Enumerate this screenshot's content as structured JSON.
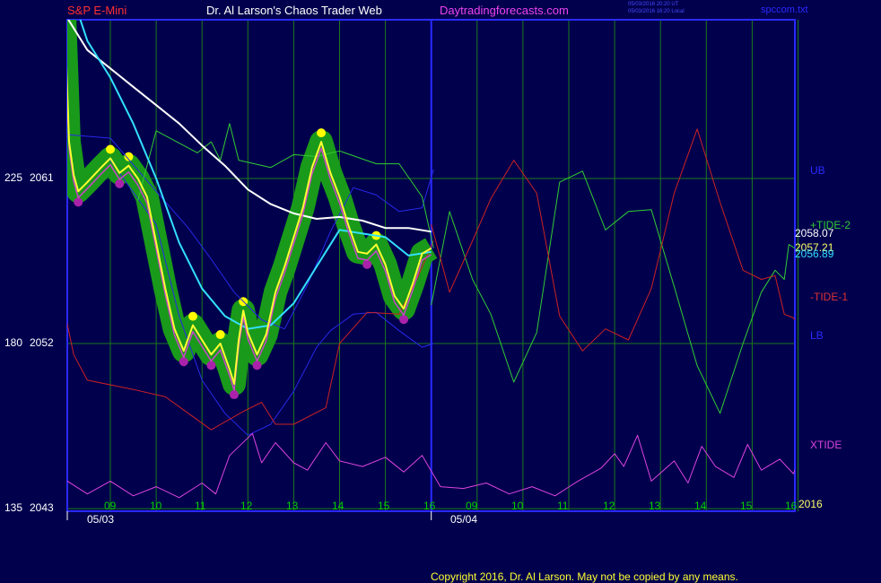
{
  "header": {
    "instrument": "S&P E-Mini",
    "title": "Dr. Al Larson's Chaos Trader Web",
    "site": "Daytradingforecasts.com",
    "stamp_line1": "05/03/2016 20:20 UT",
    "stamp_line2": "05/03/2016 16:20 Local",
    "file": "spccom.txt"
  },
  "footer": {
    "copyright": "Copyright 2016, Dr. Al Larson. May not be copied by any means."
  },
  "y_axis": {
    "labels": [
      {
        "left": "225",
        "right": "2061"
      },
      {
        "left": "180",
        "right": "2052"
      },
      {
        "left": "135",
        "right": "2043"
      }
    ]
  },
  "x_axis": {
    "day1_hours": [
      "09",
      "10",
      "11",
      "12",
      "13",
      "14",
      "15",
      "16"
    ],
    "day2_hours": [
      "09",
      "10",
      "11",
      "12",
      "13",
      "14",
      "15",
      "16"
    ],
    "dates": [
      "05/03",
      "05/04"
    ],
    "year": "2016"
  },
  "right_labels": {
    "ub": "UB",
    "tide2": "+TIDE-2",
    "price_white": "2058.07",
    "price_yellow": "2057.21",
    "price_cyan": "2056.89",
    "tide1": "-TIDE-1",
    "lb": "LB",
    "xtide": "XTIDE"
  },
  "colors": {
    "background": "#00004d",
    "grid_green": "#1c7a1c",
    "frame_blue": "#2a2aff",
    "band_blue": "#2828e8",
    "white_ma": "#ffffff",
    "cyan_ma": "#33e0ff",
    "yellow_price": "#ffff33",
    "magenta": "#cc44cc",
    "tide_green": "#33cc33",
    "tide_red": "#cc2222",
    "xtide": "#dd44dd",
    "highlight_green": "#1a9a1a",
    "high_dot": "#ffff00",
    "low_dot": "#aa22aa"
  },
  "chart_data": {
    "type": "line",
    "title": "S&P E-Mini",
    "x_dates": [
      "05/03",
      "05/04"
    ],
    "x_hours_per_day": [
      "09",
      "10",
      "11",
      "12",
      "13",
      "14",
      "15",
      "16"
    ],
    "y_ticks": [
      2043,
      2052,
      2061
    ],
    "ylim": [
      2043,
      2063
    ],
    "grid": true,
    "series": [
      {
        "name": "UB",
        "role": "upper band",
        "points": [
          [
            8.0,
            2063.4
          ],
          [
            9.0,
            2063.2
          ],
          [
            10.0,
            2060.3
          ],
          [
            10.7,
            2058.3
          ],
          [
            11.2,
            2056.6
          ],
          [
            11.7,
            2054.8
          ],
          [
            12.3,
            2053.3
          ],
          [
            12.8,
            2052.8
          ],
          [
            13.3,
            2055.2
          ],
          [
            13.8,
            2058.1
          ],
          [
            14.3,
            2060.5
          ],
          [
            14.8,
            2060.1
          ],
          [
            15.3,
            2059.2
          ],
          [
            15.8,
            2059.4
          ],
          [
            16.05,
            2061.5
          ]
        ]
      },
      {
        "name": "LB",
        "role": "lower band",
        "points": [
          [
            9.0,
            2062.0
          ],
          [
            10.0,
            2058.5
          ],
          [
            10.5,
            2053.5
          ],
          [
            11.0,
            2050.0
          ],
          [
            11.5,
            2048.2
          ],
          [
            12.0,
            2047.0
          ],
          [
            12.5,
            2047.6
          ],
          [
            13.0,
            2049.4
          ],
          [
            13.5,
            2051.8
          ],
          [
            13.8,
            2052.7
          ],
          [
            14.3,
            2053.6
          ],
          [
            14.8,
            2053.7
          ],
          [
            15.3,
            2052.7
          ],
          [
            15.8,
            2051.8
          ],
          [
            16.05,
            2052.0
          ]
        ]
      },
      {
        "name": "red envelope",
        "role": "lower envelope",
        "points": [
          [
            8.0,
            2053.8
          ],
          [
            8.2,
            2051.4
          ],
          [
            8.5,
            2050.0
          ],
          [
            9.5,
            2049.5
          ],
          [
            10.2,
            2049.1
          ],
          [
            10.7,
            2048.2
          ],
          [
            11.2,
            2047.3
          ],
          [
            11.9,
            2048.3
          ],
          [
            12.3,
            2048.8
          ],
          [
            12.6,
            2047.6
          ],
          [
            13.0,
            2047.6
          ],
          [
            13.7,
            2048.5
          ],
          [
            14.0,
            2052.0
          ],
          [
            14.6,
            2053.7
          ],
          [
            15.3,
            2053.6
          ],
          [
            15.7,
            2055.6
          ],
          [
            16.05,
            2057.6
          ]
        ]
      },
      {
        "name": "green envelope",
        "role": "upper envelope",
        "points": [
          [
            9.6,
            2059.8
          ],
          [
            10.0,
            2063.6
          ],
          [
            10.9,
            2062.4
          ],
          [
            11.2,
            2063.0
          ],
          [
            11.4,
            2062.0
          ],
          [
            11.6,
            2064.0
          ],
          [
            11.8,
            2062.0
          ],
          [
            12.5,
            2061.6
          ],
          [
            13.0,
            2062.3
          ],
          [
            13.5,
            2062.2
          ],
          [
            14.0,
            2062.5
          ],
          [
            14.8,
            2061.8
          ],
          [
            15.3,
            2061.8
          ],
          [
            15.8,
            2060.0
          ],
          [
            16.05,
            2057.2
          ]
        ]
      },
      {
        "name": "white MA",
        "points": [
          [
            8.0,
            2070
          ],
          [
            8.5,
            2068.0
          ],
          [
            9.0,
            2067.0
          ],
          [
            9.5,
            2066.0
          ],
          [
            10.0,
            2065.0
          ],
          [
            10.5,
            2064.0
          ],
          [
            11.0,
            2062.8
          ],
          [
            11.5,
            2061.7
          ],
          [
            12.0,
            2060.4
          ],
          [
            12.5,
            2059.6
          ],
          [
            13.0,
            2059.1
          ],
          [
            13.5,
            2058.8
          ],
          [
            14.0,
            2058.9
          ],
          [
            14.5,
            2058.7
          ],
          [
            15.0,
            2058.3
          ],
          [
            15.5,
            2058.3
          ],
          [
            16.0,
            2058.1
          ]
        ]
      },
      {
        "name": "cyan MA",
        "points": [
          [
            8.3,
            2070
          ],
          [
            8.5,
            2068.5
          ],
          [
            9.0,
            2066.5
          ],
          [
            9.5,
            2064.0
          ],
          [
            10.0,
            2061.0
          ],
          [
            10.5,
            2057.5
          ],
          [
            11.0,
            2055.0
          ],
          [
            11.5,
            2053.5
          ],
          [
            12.0,
            2052.8
          ],
          [
            12.5,
            2053.0
          ],
          [
            13.0,
            2054.2
          ],
          [
            13.5,
            2056.2
          ],
          [
            14.0,
            2058.2
          ],
          [
            14.5,
            2058.0
          ],
          [
            15.0,
            2057.8
          ],
          [
            15.5,
            2056.8
          ],
          [
            16.0,
            2057.0
          ]
        ]
      },
      {
        "name": "yellow price",
        "points": [
          [
            8.0,
            2070
          ],
          [
            8.1,
            2063.0
          ],
          [
            8.2,
            2061.2
          ],
          [
            8.3,
            2060.3
          ],
          [
            8.5,
            2060.8
          ],
          [
            8.8,
            2061.6
          ],
          [
            9.0,
            2062.1
          ],
          [
            9.2,
            2061.3
          ],
          [
            9.4,
            2061.7
          ],
          [
            9.6,
            2061.0
          ],
          [
            9.8,
            2060.0
          ],
          [
            10.0,
            2057.5
          ],
          [
            10.2,
            2055.0
          ],
          [
            10.4,
            2052.8
          ],
          [
            10.6,
            2051.6
          ],
          [
            10.8,
            2053.0
          ],
          [
            11.0,
            2052.2
          ],
          [
            11.2,
            2051.4
          ],
          [
            11.4,
            2052.0
          ],
          [
            11.6,
            2050.6
          ],
          [
            11.7,
            2049.8
          ],
          [
            11.8,
            2052.2
          ],
          [
            11.9,
            2053.8
          ],
          [
            12.0,
            2052.6
          ],
          [
            12.2,
            2051.4
          ],
          [
            12.4,
            2052.5
          ],
          [
            12.6,
            2054.8
          ],
          [
            12.8,
            2056.2
          ],
          [
            13.0,
            2057.8
          ],
          [
            13.2,
            2059.4
          ],
          [
            13.4,
            2061.6
          ],
          [
            13.6,
            2063.0
          ],
          [
            13.8,
            2061.3
          ],
          [
            14.0,
            2060.0
          ],
          [
            14.2,
            2058.4
          ],
          [
            14.4,
            2057.0
          ],
          [
            14.6,
            2056.9
          ],
          [
            14.8,
            2057.4
          ],
          [
            15.0,
            2056.3
          ],
          [
            15.2,
            2054.6
          ],
          [
            15.4,
            2053.9
          ],
          [
            15.6,
            2055.3
          ],
          [
            15.8,
            2056.9
          ],
          [
            16.0,
            2057.2
          ]
        ]
      },
      {
        "name": "+TIDE-2",
        "role": "forecast",
        "points": [
          [
            16.0,
            2054.1
          ],
          [
            16.4,
            2059.2
          ],
          [
            16.9,
            2055.5
          ],
          [
            17.3,
            2053.6
          ],
          [
            17.8,
            2049.9
          ],
          [
            18.3,
            2052.6
          ],
          [
            18.8,
            2060.8
          ],
          [
            19.3,
            2061.4
          ],
          [
            19.8,
            2058.2
          ],
          [
            20.3,
            2059.2
          ],
          [
            20.8,
            2059.3
          ],
          [
            21.3,
            2055.1
          ],
          [
            21.8,
            2050.8
          ],
          [
            22.3,
            2048.2
          ],
          [
            22.8,
            2052.0
          ],
          [
            23.2,
            2054.8
          ],
          [
            23.5,
            2056.0
          ],
          [
            23.7,
            2055.5
          ],
          [
            23.8,
            2057.4
          ],
          [
            24.0,
            2057.1
          ],
          [
            24.1,
            2058.4
          ]
        ]
      },
      {
        "name": "-TIDE-1",
        "role": "forecast",
        "points": [
          [
            16.0,
            2058.5
          ],
          [
            16.4,
            2054.8
          ],
          [
            16.9,
            2057.6
          ],
          [
            17.3,
            2059.9
          ],
          [
            17.8,
            2062.0
          ],
          [
            18.3,
            2060.2
          ],
          [
            18.8,
            2053.5
          ],
          [
            19.3,
            2051.6
          ],
          [
            19.8,
            2052.8
          ],
          [
            20.3,
            2052.2
          ],
          [
            20.8,
            2055.0
          ],
          [
            21.3,
            2060.2
          ],
          [
            21.8,
            2063.7
          ],
          [
            22.3,
            2059.7
          ],
          [
            22.8,
            2056.0
          ],
          [
            23.2,
            2055.5
          ],
          [
            23.5,
            2055.7
          ],
          [
            23.7,
            2053.6
          ],
          [
            23.9,
            2053.4
          ],
          [
            24.1,
            2052.8
          ]
        ]
      },
      {
        "name": "XTIDE",
        "role": "oscillator",
        "points": [
          [
            8.0,
            2044.6
          ],
          [
            8.5,
            2043.8
          ],
          [
            9.0,
            2044.5
          ],
          [
            9.5,
            2043.7
          ],
          [
            10.0,
            2044.2
          ],
          [
            10.5,
            2043.6
          ],
          [
            11.0,
            2044.4
          ],
          [
            11.3,
            2043.8
          ],
          [
            11.6,
            2045.9
          ],
          [
            12.1,
            2047.1
          ],
          [
            12.3,
            2045.5
          ],
          [
            12.6,
            2046.6
          ],
          [
            13.0,
            2045.5
          ],
          [
            13.3,
            2045.1
          ],
          [
            13.7,
            2046.6
          ],
          [
            14.0,
            2045.6
          ],
          [
            14.5,
            2045.3
          ],
          [
            15.0,
            2045.8
          ],
          [
            15.4,
            2045.0
          ],
          [
            15.8,
            2045.9
          ],
          [
            16.2,
            2044.2
          ],
          [
            16.7,
            2044.1
          ],
          [
            17.2,
            2044.4
          ],
          [
            17.7,
            2043.8
          ],
          [
            18.2,
            2044.2
          ],
          [
            18.7,
            2043.7
          ],
          [
            19.2,
            2044.5
          ],
          [
            19.7,
            2045.2
          ],
          [
            20.0,
            2046.0
          ],
          [
            20.2,
            2045.3
          ],
          [
            20.5,
            2047.0
          ],
          [
            20.8,
            2044.5
          ],
          [
            21.3,
            2045.6
          ],
          [
            21.6,
            2044.4
          ],
          [
            21.9,
            2046.4
          ],
          [
            22.2,
            2045.3
          ],
          [
            22.6,
            2044.7
          ],
          [
            22.9,
            2046.5
          ],
          [
            23.2,
            2045.1
          ],
          [
            23.6,
            2045.7
          ],
          [
            23.9,
            2044.9
          ],
          [
            24.1,
            2046.1
          ]
        ]
      }
    ]
  }
}
